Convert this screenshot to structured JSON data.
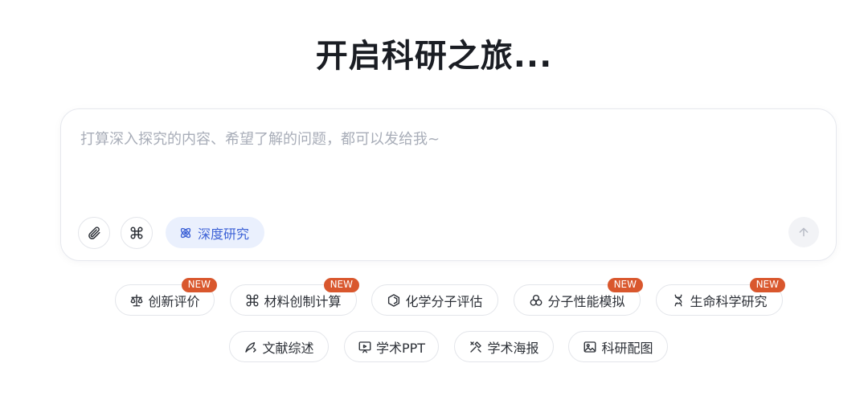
{
  "title": "开启科研之旅...",
  "composer": {
    "placeholder": "打算深入探究的内容、希望了解的问题，都可以发给我~",
    "deep_research_label": "深度研究"
  },
  "badge_label": "NEW",
  "chips_row1": [
    {
      "label": "创新评价",
      "icon": "scale-icon",
      "badge": true
    },
    {
      "label": "材料创制计算",
      "icon": "command-icon",
      "badge": true
    },
    {
      "label": "化学分子评估",
      "icon": "hexagon-icon",
      "badge": false
    },
    {
      "label": "分子性能模拟",
      "icon": "circles-icon",
      "badge": true
    },
    {
      "label": "生命科学研究",
      "icon": "dna-icon",
      "badge": true
    }
  ],
  "chips_row2": [
    {
      "label": "文献综述",
      "icon": "pen-icon"
    },
    {
      "label": "学术PPT",
      "icon": "presentation-icon"
    },
    {
      "label": "学术海报",
      "icon": "tools-icon"
    },
    {
      "label": "科研配图",
      "icon": "image-icon"
    }
  ],
  "colors": {
    "accent": "#3d62d6",
    "badge": "#d9572d",
    "border": "#e3e5ea"
  }
}
